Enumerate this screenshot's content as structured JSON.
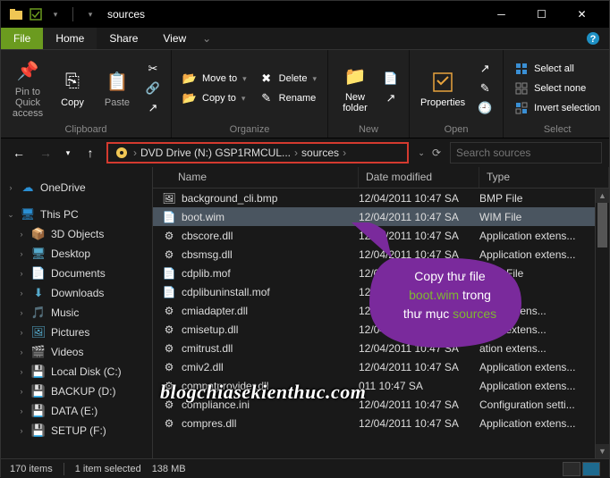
{
  "window": {
    "title": "sources"
  },
  "tabs": {
    "file": "File",
    "home": "Home",
    "share": "Share",
    "view": "View"
  },
  "ribbon": {
    "clipboard": {
      "label": "Clipboard",
      "pin": "Pin to Quick\naccess",
      "copy": "Copy",
      "paste": "Paste"
    },
    "organize": {
      "label": "Organize",
      "moveto": "Move to",
      "copyto": "Copy to",
      "delete": "Delete",
      "rename": "Rename"
    },
    "new": {
      "label": "New",
      "newfolder": "New\nfolder"
    },
    "open": {
      "label": "Open",
      "properties": "Properties"
    },
    "select": {
      "label": "Select",
      "all": "Select all",
      "none": "Select none",
      "invert": "Invert selection"
    }
  },
  "breadcrumb": {
    "drive": "DVD Drive (N:) GSP1RMCUL...",
    "folder": "sources"
  },
  "search": {
    "placeholder": "Search sources"
  },
  "nav": {
    "onedrive": "OneDrive",
    "thispc": "This PC",
    "items": [
      "3D Objects",
      "Desktop",
      "Documents",
      "Downloads",
      "Music",
      "Pictures",
      "Videos",
      "Local Disk (C:)",
      "BACKUP (D:)",
      "DATA (E:)",
      "SETUP (F:)"
    ]
  },
  "columns": {
    "name": "Name",
    "date": "Date modified",
    "type": "Type"
  },
  "files": [
    {
      "name": "background_cli.bmp",
      "date": "12/04/2011 10:47 SA",
      "type": "BMP File",
      "icon": "image"
    },
    {
      "name": "boot.wim",
      "date": "12/04/2011 10:47 SA",
      "type": "WIM File",
      "icon": "file",
      "selected": true
    },
    {
      "name": "cbscore.dll",
      "date": "12/04/2011 10:47 SA",
      "type": "Application extens...",
      "icon": "dll"
    },
    {
      "name": "cbsmsg.dll",
      "date": "12/04/2011 10:47 SA",
      "type": "Application extens...",
      "icon": "dll"
    },
    {
      "name": "cdplib.mof",
      "date": "12/04/2011 10:47 SA",
      "type": "MOF File",
      "icon": "file"
    },
    {
      "name": "cdplibuninstall.mof",
      "date": "12/04/2011 10:47 SA",
      "type": "F File",
      "icon": "file"
    },
    {
      "name": "cmiadapter.dll",
      "date": "12/04/2011 10:47 SA",
      "type": "ation extens...",
      "icon": "dll"
    },
    {
      "name": "cmisetup.dll",
      "date": "12/04/2011 10:47 SA",
      "type": "ation extens...",
      "icon": "dll"
    },
    {
      "name": "cmitrust.dll",
      "date": "12/04/2011 10:47 SA",
      "type": "ation extens...",
      "icon": "dll"
    },
    {
      "name": "cmiv2.dll",
      "date": "12/04/2011 10:47 SA",
      "type": "Application extens...",
      "icon": "dll"
    },
    {
      "name": "compatprovider.dll",
      "date": "011 10:47 SA",
      "type": "Application extens...",
      "icon": "dll"
    },
    {
      "name": "compliance.ini",
      "date": "12/04/2011 10:47 SA",
      "type": "Configuration setti...",
      "icon": "ini"
    },
    {
      "name": "compres.dll",
      "date": "12/04/2011 10:47 SA",
      "type": "Application extens...",
      "icon": "dll"
    }
  ],
  "status": {
    "count": "170 items",
    "selected": "1 item selected",
    "size": "138 MB"
  },
  "callout": {
    "line1": "Copy thư file",
    "highlight1": "boot.wim",
    "mid": " trong",
    "line3": "thư mục ",
    "highlight2": "sources"
  },
  "watermark": "blogchiasekienthuc.com"
}
